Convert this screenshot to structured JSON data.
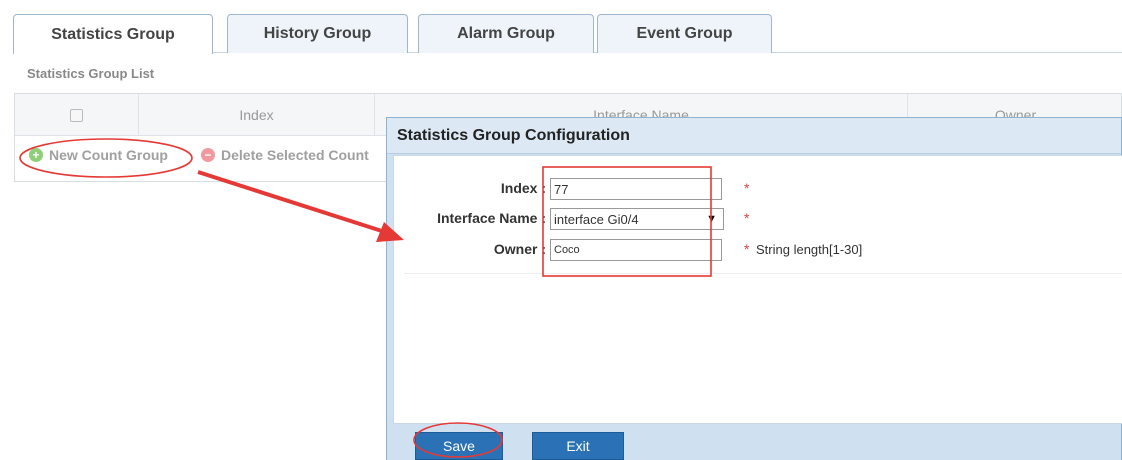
{
  "tabs": [
    {
      "label": "Statistics Group",
      "active": true
    },
    {
      "label": "History Group",
      "active": false
    },
    {
      "label": "Alarm Group",
      "active": false
    },
    {
      "label": "Event Group",
      "active": false
    }
  ],
  "section_title": "Statistics Group List",
  "table": {
    "columns": [
      "",
      "Index",
      "Interface Name",
      "Owner"
    ]
  },
  "toolbar": {
    "new_label": "New Count Group",
    "delete_label": "Delete Selected Count"
  },
  "dialog": {
    "title": "Statistics Group Configuration",
    "fields": {
      "index": {
        "label": "Index :",
        "value": "77",
        "required": "*"
      },
      "interface": {
        "label": "Interface Name :",
        "value": "interface Gi0/4",
        "required": "*"
      },
      "owner": {
        "label": "Owner :",
        "value": "Coco",
        "required": "*",
        "hint": "String length[1-30]"
      }
    },
    "save_label": "Save",
    "exit_label": "Exit"
  },
  "colors": {
    "annotation": "#e53935",
    "button": "#2a72b5",
    "dialog_frame": "#cfe1f1"
  }
}
